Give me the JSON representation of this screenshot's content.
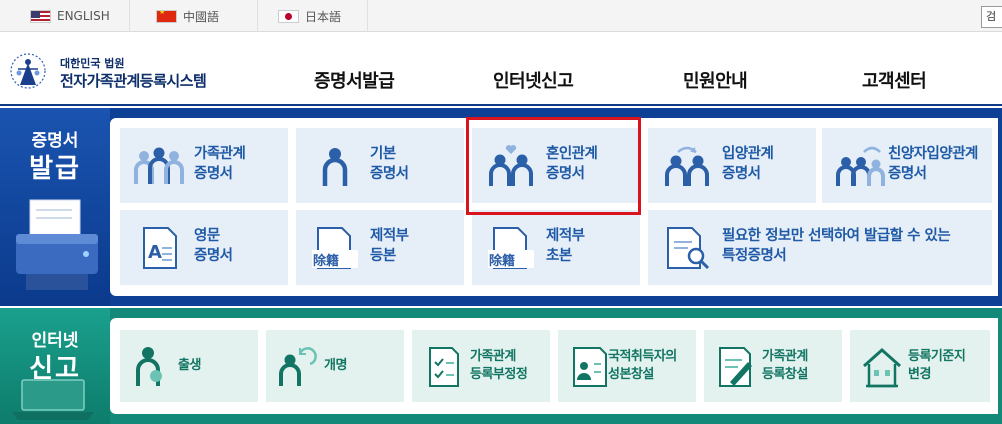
{
  "languages": [
    {
      "label": "ENGLISH"
    },
    {
      "label": "中國語"
    },
    {
      "label": "日本語"
    }
  ],
  "search_button": "검",
  "header": {
    "org": "대한민국 법원",
    "system": "전자가족관계등록시스템",
    "nav": [
      "증명서발급",
      "인터넷신고",
      "민원안내",
      "고객센터"
    ]
  },
  "certificates": {
    "side_line1": "증명서",
    "side_line2": "발급",
    "tiles": [
      {
        "line1": "가족관계",
        "line2": "증명서",
        "icon": "family-icon"
      },
      {
        "line1": "기본",
        "line2": "증명서",
        "icon": "person-icon"
      },
      {
        "line1": "혼인관계",
        "line2": "증명서",
        "icon": "couple-heart-icon"
      },
      {
        "line1": "입양관계",
        "line2": "증명서",
        "icon": "adoption-icon"
      },
      {
        "line1": "친양자입양관계",
        "line2": "증명서",
        "icon": "full-adoption-icon"
      },
      {
        "line1": "영문",
        "line2": "증명서",
        "icon": "english-document-icon"
      },
      {
        "line1": "제적부",
        "line2": "등본",
        "icon": "removed-register-icon",
        "stamp": "除籍"
      },
      {
        "line1": "제적부",
        "line2": "초본",
        "icon": "removed-register-icon",
        "stamp": "除籍"
      },
      {
        "line1": "필요한 정보만 선택하여 발급할 수 있는",
        "line2": "특정증명서",
        "icon": "document-search-icon"
      }
    ]
  },
  "internet_report": {
    "side_line1": "인터넷",
    "side_line2": "신고",
    "tiles": [
      {
        "line1": "출생",
        "line2": "",
        "icon": "birth-icon"
      },
      {
        "line1": "개명",
        "line2": "",
        "icon": "rename-icon"
      },
      {
        "line1": "가족관계",
        "line2": "등록부정정",
        "icon": "checklist-icon"
      },
      {
        "line1": "국적취득자의",
        "line2": "성본창설",
        "icon": "id-card-icon"
      },
      {
        "line1": "가족관계",
        "line2": "등록창설",
        "icon": "pen-document-icon"
      },
      {
        "line1": "등록기준지",
        "line2": "변경",
        "icon": "house-icon"
      }
    ]
  },
  "colors": {
    "navy": "#0e4196",
    "teal": "#138a79",
    "cert_text": "#1f5aa6",
    "net_text": "#127563",
    "highlight": "#d9141f"
  }
}
